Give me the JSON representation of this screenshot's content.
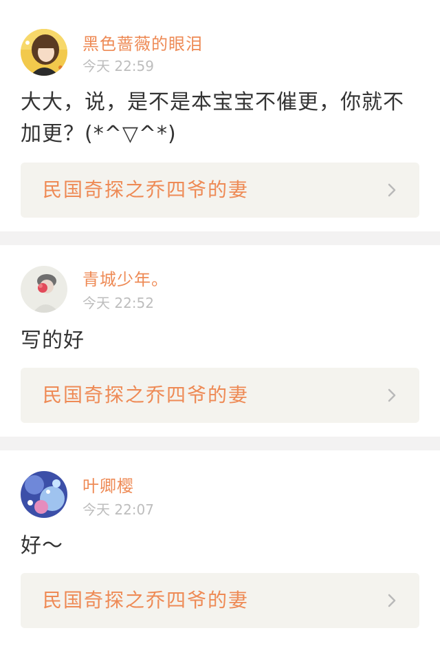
{
  "colors": {
    "accent": "#ee8a55",
    "timestamp": "#bdbdbd",
    "text": "#333333",
    "book_bg": "#f4f3ee",
    "separator": "#f3f2f2",
    "indicator": "#f0609a"
  },
  "comments": [
    {
      "username": "黑色蔷薇的眼泪",
      "time": "今天 22:59",
      "text": "大大，说，是不是本宝宝不催更，你就不加更？(*^▽^*)",
      "book_title": "民国奇探之乔四爷的妻",
      "chevron_icon": "chevron-right-icon"
    },
    {
      "username": "青城少年。",
      "time": "今天 22:52",
      "text": "写的好",
      "book_title": "民国奇探之乔四爷的妻",
      "chevron_icon": "chevron-right-icon"
    },
    {
      "username": "叶卿樱",
      "time": "今天 22:07",
      "text": "好～",
      "book_title": "民国奇探之乔四爷的妻",
      "chevron_icon": "chevron-right-icon"
    }
  ]
}
